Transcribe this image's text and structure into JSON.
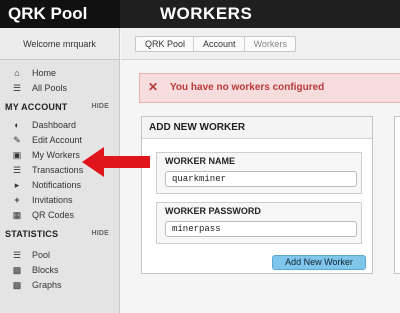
{
  "header": {
    "brand": "QRK Pool",
    "page_title": "WORKERS"
  },
  "sidebar": {
    "welcome": "Welcome mrquark",
    "top_items": [
      {
        "label": "Home",
        "icon": "home-icon"
      },
      {
        "label": "All Pools",
        "icon": "list-icon"
      }
    ],
    "sections": [
      {
        "title": "MY ACCOUNT",
        "toggle": "HIDE",
        "items": [
          {
            "label": "Dashboard",
            "icon": "dashboard-icon"
          },
          {
            "label": "Edit Account",
            "icon": "edit-icon"
          },
          {
            "label": "My Workers",
            "icon": "desktop-icon"
          },
          {
            "label": "Transactions",
            "icon": "list-icon"
          },
          {
            "label": "Notifications",
            "icon": "megaphone-icon"
          },
          {
            "label": "Invitations",
            "icon": "plus-icon"
          },
          {
            "label": "QR Codes",
            "icon": "qr-icon"
          }
        ]
      },
      {
        "title": "STATISTICS",
        "toggle": "HIDE",
        "items": [
          {
            "label": "Pool",
            "icon": "list-icon"
          },
          {
            "label": "Blocks",
            "icon": "grid-icon"
          },
          {
            "label": "Graphs",
            "icon": "chart-icon"
          }
        ]
      }
    ]
  },
  "breadcrumb": [
    "QRK Pool",
    "Account",
    "Workers"
  ],
  "alert": {
    "icon": "close-icon",
    "message": "You have no workers configured",
    "color": "#b93a3a"
  },
  "add_worker": {
    "title": "ADD NEW WORKER",
    "name_label": "WORKER NAME",
    "name_value": "quarkminer",
    "password_label": "WORKER PASSWORD",
    "password_value": "minerpass",
    "submit_label": "Add New Worker",
    "submit_color": "#7fc6ea"
  },
  "annotation": {
    "arrow_color": "#e0141b"
  }
}
